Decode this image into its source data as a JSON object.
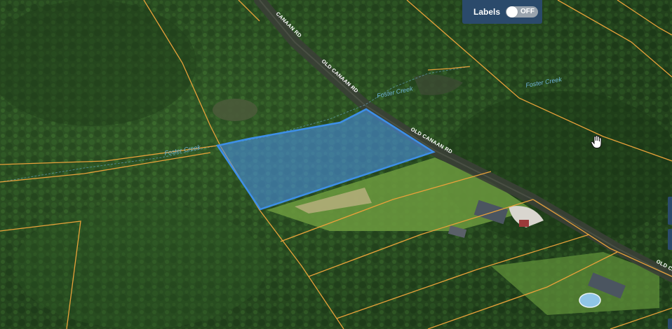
{
  "map": {
    "road_labels": [
      "OLD CANAAN RD",
      "OLD CANAAN RD",
      "CANAAN RD",
      "OLD CANAAN RD"
    ],
    "creek_labels": [
      "Foster Creek",
      "Foster Creek",
      "Foster Creek"
    ]
  },
  "controls": {
    "labels_toggle": {
      "label": "Labels",
      "state": "OFF"
    }
  },
  "colors": {
    "parcel_line": "#e8a13a",
    "selected_fill": "#4a90e2",
    "panel_bg": "#2b4a6b"
  },
  "icons": [
    "hand-cursor-icon"
  ]
}
